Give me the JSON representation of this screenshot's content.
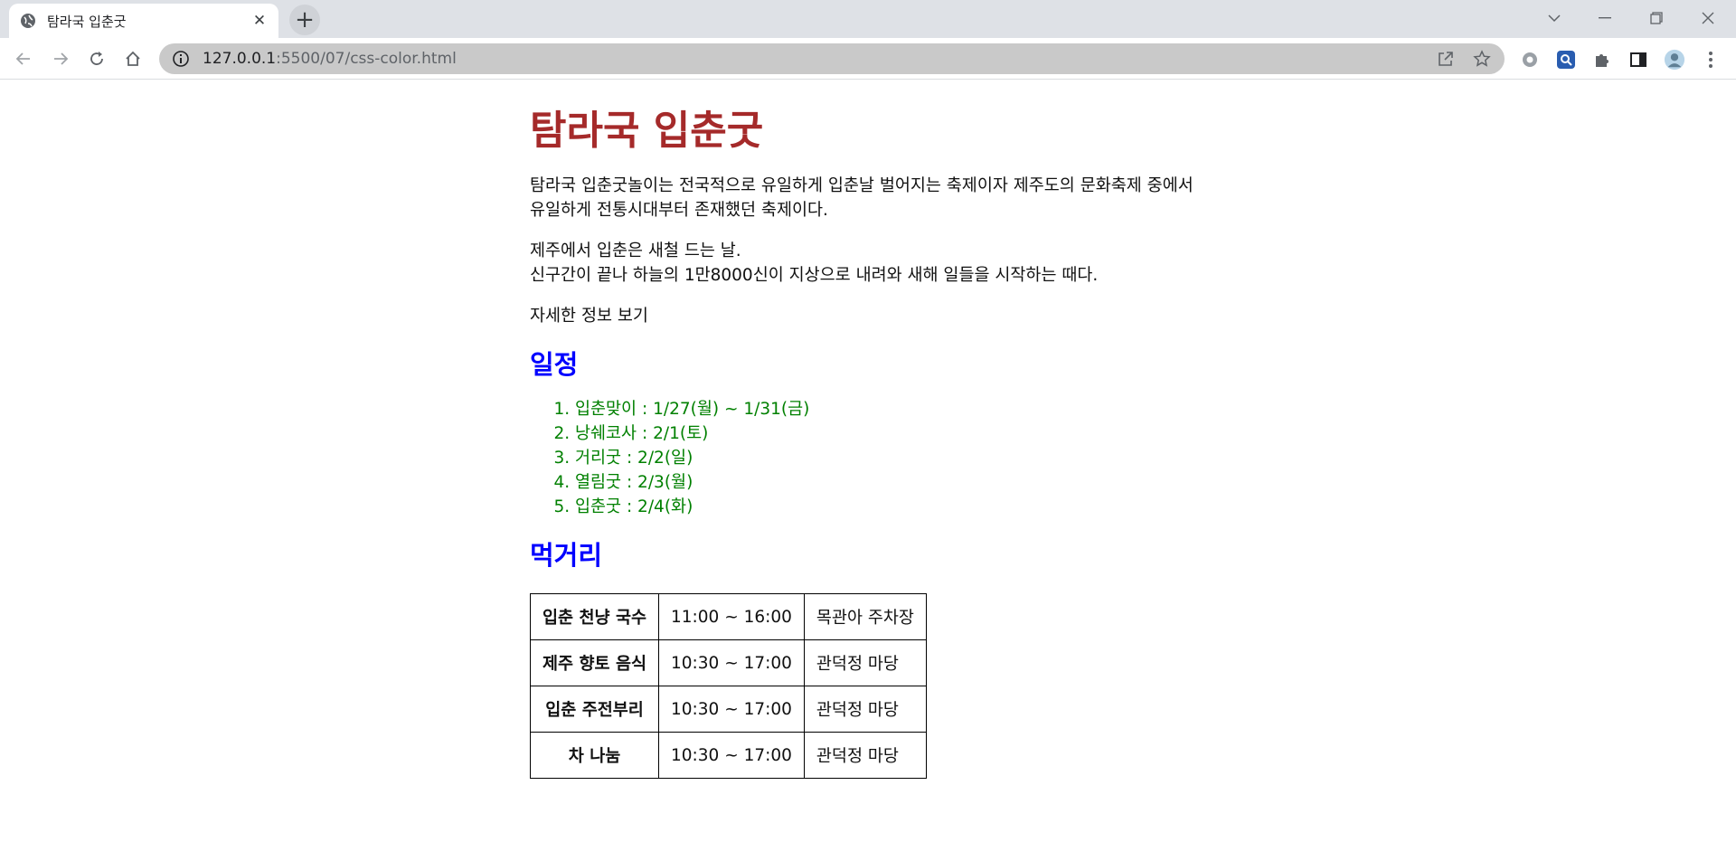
{
  "browser": {
    "tab_title": "탐라국 입춘굿",
    "url_host": "127.0.0.1",
    "url_path": ":5500/07/css-color.html",
    "icons": {
      "favicon": "globe-icon",
      "close": "close-icon",
      "new_tab": "plus-icon",
      "back": "arrow-left-icon",
      "forward": "arrow-right-icon",
      "reload": "reload-icon",
      "home": "home-icon",
      "site_info": "info-icon",
      "share": "share-icon",
      "bookmark": "star-icon",
      "extensions": "puzzle-icon",
      "side_panel": "side-panel-icon",
      "profile": "avatar",
      "menu": "kebab-menu-icon"
    }
  },
  "page": {
    "title": "탐라국 입춘굿",
    "intro": "탐라국 입춘굿놀이는 전국적으로 유일하게 입춘날 벌어지는 축제이자 제주도의 문화축제 중에서 유일하게 전통시대부터 존재했던 축제이다.",
    "para2_line1": "제주에서 입춘은 새철 드는 날.",
    "para2_line2": "신구간이 끝나 하늘의 1만8000신이 지상으로 내려와 새해 일들을 시작하는 때다.",
    "more_link": "자세한 정보 보기",
    "schedule_heading": "일정",
    "schedule": [
      "입춘맞이 : 1/27(월) ~ 1/31(금)",
      "낭쉐코사 : 2/1(토)",
      "거리굿 : 2/2(일)",
      "열림굿 : 2/3(월)",
      "입춘굿 : 2/4(화)"
    ],
    "food_heading": "먹거리",
    "food_table": [
      {
        "name": "입춘 천냥 국수",
        "time": "11:00 ~ 16:00",
        "place": "목관아 주차장"
      },
      {
        "name": "제주 향토 음식",
        "time": "10:30 ~ 17:00",
        "place": "관덕정 마당"
      },
      {
        "name": "입춘 주전부리",
        "time": "10:30 ~ 17:00",
        "place": "관덕정 마당"
      },
      {
        "name": "차 나눔",
        "time": "10:30 ~ 17:00",
        "place": "관덕정 마당"
      }
    ]
  },
  "colors": {
    "title": "#a52a2a",
    "heading": "#0000ff",
    "list": "#008000"
  }
}
